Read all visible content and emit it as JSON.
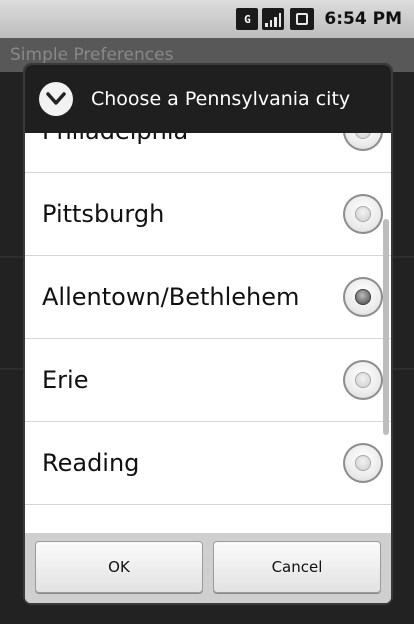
{
  "status_bar": {
    "time": "6:54 PM",
    "icons": [
      "data-transfer-icon",
      "signal-icon",
      "battery-icon"
    ],
    "transfer_glyph": "G"
  },
  "background_app": {
    "title": "Simple Preferences"
  },
  "dialog": {
    "icon": "chevron-down-circle-icon",
    "title": "Choose a Pennsylvania city",
    "items": [
      {
        "label": "Philadelphia",
        "checked": false
      },
      {
        "label": "Pittsburgh",
        "checked": false
      },
      {
        "label": "Allentown/Bethlehem",
        "checked": true
      },
      {
        "label": "Erie",
        "checked": false
      },
      {
        "label": "Reading",
        "checked": false
      }
    ],
    "buttons": {
      "ok": "OK",
      "cancel": "Cancel"
    }
  }
}
